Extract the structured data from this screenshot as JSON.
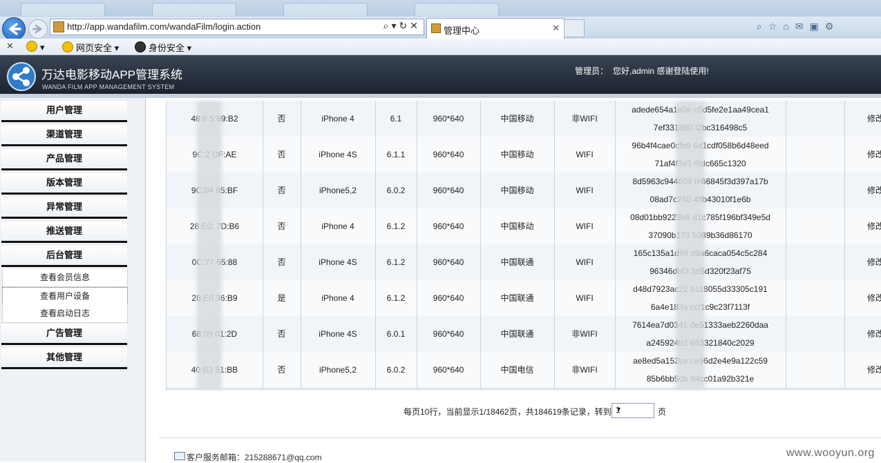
{
  "browser": {
    "url": "http://app.wandafilm.com/wandaFilm/login.action",
    "active_tab_title": "管理中心",
    "favorites": {
      "web_security": "网页安全",
      "identity_security": "身份安全"
    }
  },
  "header": {
    "title": "万达电影移动APP管理系统",
    "subtitle": "WANDA FILM APP MANAGEMENT SYSTEM",
    "admin_label": "管理员：",
    "welcome": "您好,admin 感谢登陆使用!"
  },
  "sidebar": {
    "menus": [
      {
        "label": "用户管理"
      },
      {
        "label": "渠道管理"
      },
      {
        "label": "产品管理"
      },
      {
        "label": "版本管理"
      },
      {
        "label": "异常管理"
      },
      {
        "label": "推送管理"
      },
      {
        "label": "后台管理"
      }
    ],
    "submenus": [
      {
        "label": "查看会员信息"
      },
      {
        "label": "查看用户设备"
      },
      {
        "label": "查看启动日志"
      }
    ],
    "menus_after": [
      {
        "label": "广告管理"
      },
      {
        "label": "其他管理"
      }
    ]
  },
  "table": {
    "rows": [
      {
        "mac": "48:6         5:69:B2",
        "flag": "否",
        "model": "iPhone 4",
        "os": "6.1",
        "res": "960*640",
        "carrier": "中国移动",
        "net": "非WIFI",
        "token1": "adede654a1a0e         c5d5fe2e1aa49cea1",
        "token2": "7ef331880            f2bc316498c5",
        "action": "修改"
      },
      {
        "mac": "9C:2         DF:AE",
        "flag": "否",
        "model": "iPhone 4S",
        "os": "6.1.1",
        "res": "960*640",
        "carrier": "中国移动",
        "net": "WIFI",
        "token1": "96b4f4cae0cfb9         6d1cdf058b6d48eed",
        "token2": "71af4f3e3           6fdc665c1320",
        "action": "修改"
      },
      {
        "mac": "9C:04         85:BF",
        "flag": "否",
        "model": "iPhone5,2",
        "os": "6.0.2",
        "res": "960*640",
        "carrier": "中国移动",
        "net": "WIFI",
        "token1": "8d5963c944609         fe66845f3d397a17b",
        "token2": "08ad7c240           4ffb43010f1e6b",
        "action": "修改"
      },
      {
        "mac": "28:E0:         7D:B6",
        "flag": "否",
        "model": "iPhone 4",
        "os": "6.1.2",
        "res": "960*640",
        "carrier": "中国移动",
        "net": "WIFI",
        "token1": "08d01bb9223b6         d1c785f196bf349e5d",
        "token2": "37090b173           5089b36d86170",
        "action": "修改"
      },
      {
        "mac": "0C:77         65:88",
        "flag": "否",
        "model": "iPhone 4S",
        "os": "6.1.2",
        "res": "960*640",
        "carrier": "中国联通",
        "net": "WIFI",
        "token1": "165c135a1d99         d9a6caca054c5c284",
        "token2": "96346dbf3           3d5d320f23af75",
        "action": "修改"
      },
      {
        "mac": "28:E0         36:B9",
        "flag": "是",
        "model": "iPhone 4",
        "os": "6.1.2",
        "res": "960*640",
        "carrier": "中国联通",
        "net": "WIFI",
        "token1": "d48d7923ac22         b118055d33305c191",
        "token2": "6a4e183a           ccf1c9c23f7113f",
        "action": "修改"
      },
      {
        "mac": "68:09         01:2D",
        "flag": "否",
        "model": "iPhone 4S",
        "os": "6.0.1",
        "res": "960*640",
        "carrier": "中国联通",
        "net": "非WIFI",
        "token1": "7614ea7d0341         de51333aeb2260daa",
        "token2": "a245924b2           663321840c2029",
        "action": "修改"
      },
      {
        "mac": "40:B3         51:BB",
        "flag": "否",
        "model": "iPhone5,2",
        "os": "6.0.2",
        "res": "960*640",
        "carrier": "中国电信",
        "net": "非WIFI",
        "token1": "ae8ed5a152ce         ce96d2e4e9a122c59",
        "token2": "85b6bb50b           94cc01a92b321e",
        "action": "修改"
      }
    ]
  },
  "pager": {
    "text": "每页10行，当前显示1/18462页，共184619条记录，转到",
    "page_value": "1",
    "suffix": "页"
  },
  "footer": {
    "email": "客户服务邮箱：215288671@qq.com"
  },
  "watermark": "www.wooyun.org"
}
